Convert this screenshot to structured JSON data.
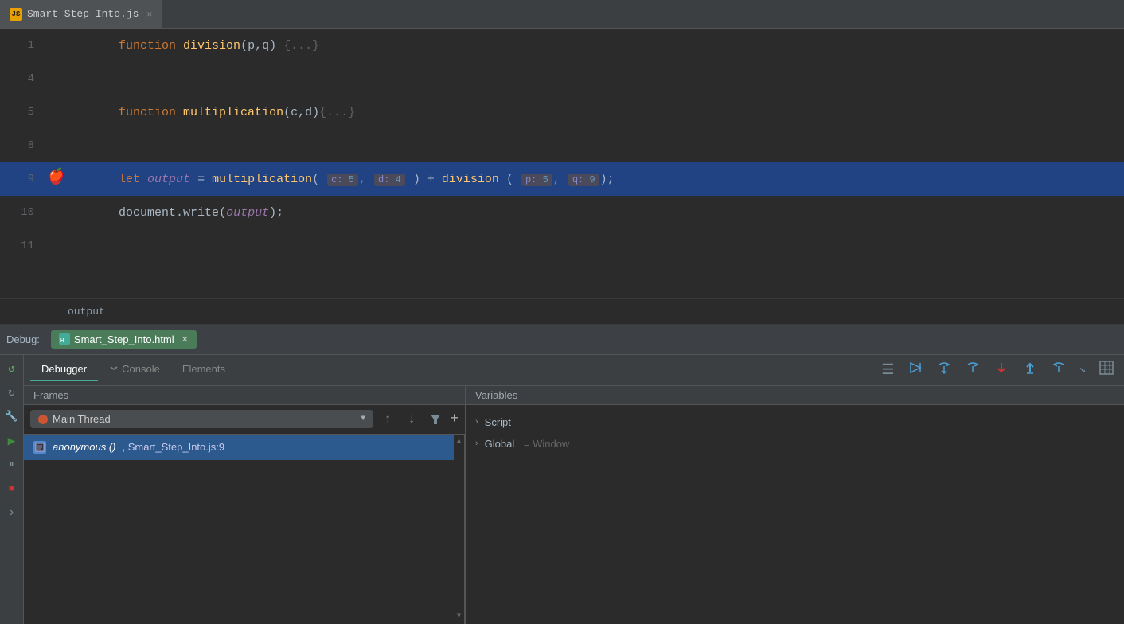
{
  "tabBar": {
    "tabs": [
      {
        "id": "tab-js",
        "icon": "JS",
        "label": "Smart_Step_Into.js",
        "active": true
      }
    ]
  },
  "codeEditor": {
    "lines": [
      {
        "number": 1,
        "breakpoint": false,
        "content": "function division(p,q) {...}",
        "active": false,
        "collapsed": true
      },
      {
        "number": 4,
        "breakpoint": false,
        "content": "",
        "active": false
      },
      {
        "number": 5,
        "breakpoint": false,
        "content": "function multiplication(c,d){...}",
        "active": false,
        "collapsed": true
      },
      {
        "number": 8,
        "breakpoint": false,
        "content": "",
        "active": false
      },
      {
        "number": 9,
        "breakpoint": true,
        "content": "let output = multiplication( c: 5, d: 4 ) + division ( p: 5, q: 9);",
        "active": true
      },
      {
        "number": 10,
        "breakpoint": false,
        "content": "document.write(output);",
        "active": false
      },
      {
        "number": 11,
        "breakpoint": false,
        "content": "",
        "active": false
      }
    ],
    "outputLabel": "output"
  },
  "debugBar": {
    "label": "Debug:",
    "tab": {
      "label": "Smart_Step_Into.html",
      "icon": "html"
    }
  },
  "debuggerPanel": {
    "tabs": [
      {
        "id": "debugger",
        "label": "Debugger",
        "active": true
      },
      {
        "id": "console",
        "label": "Console",
        "active": false
      },
      {
        "id": "elements",
        "label": "Elements",
        "active": false
      }
    ],
    "toolbar": {
      "icons": [
        "resume",
        "step-over-in",
        "step-over",
        "step-into",
        "step-out",
        "step-back",
        "smart-step",
        "table"
      ]
    },
    "frames": {
      "header": "Frames",
      "thread": {
        "dot_color": "#cc5533",
        "label": "Main Thread"
      },
      "items": [
        {
          "selected": true,
          "name": "anonymous ()",
          "location": "Smart_Step_Into.js:9"
        }
      ]
    },
    "variables": {
      "header": "Variables",
      "items": [
        {
          "label": "Script",
          "value": ""
        },
        {
          "label": "Global",
          "value": "= Window"
        }
      ]
    }
  },
  "sidebarIcons": [
    {
      "id": "resume-icon",
      "symbol": "↺",
      "active": false
    },
    {
      "id": "refresh-icon",
      "symbol": "↻",
      "active": false
    },
    {
      "id": "wrench-icon",
      "symbol": "🔧",
      "active": false
    },
    {
      "id": "play-icon",
      "symbol": "▶",
      "active": true
    },
    {
      "id": "pause-icon",
      "symbol": "⏸",
      "active": false
    },
    {
      "id": "stop-icon",
      "symbol": "■",
      "active": false
    },
    {
      "id": "more-icon",
      "symbol": "›",
      "active": false
    }
  ]
}
